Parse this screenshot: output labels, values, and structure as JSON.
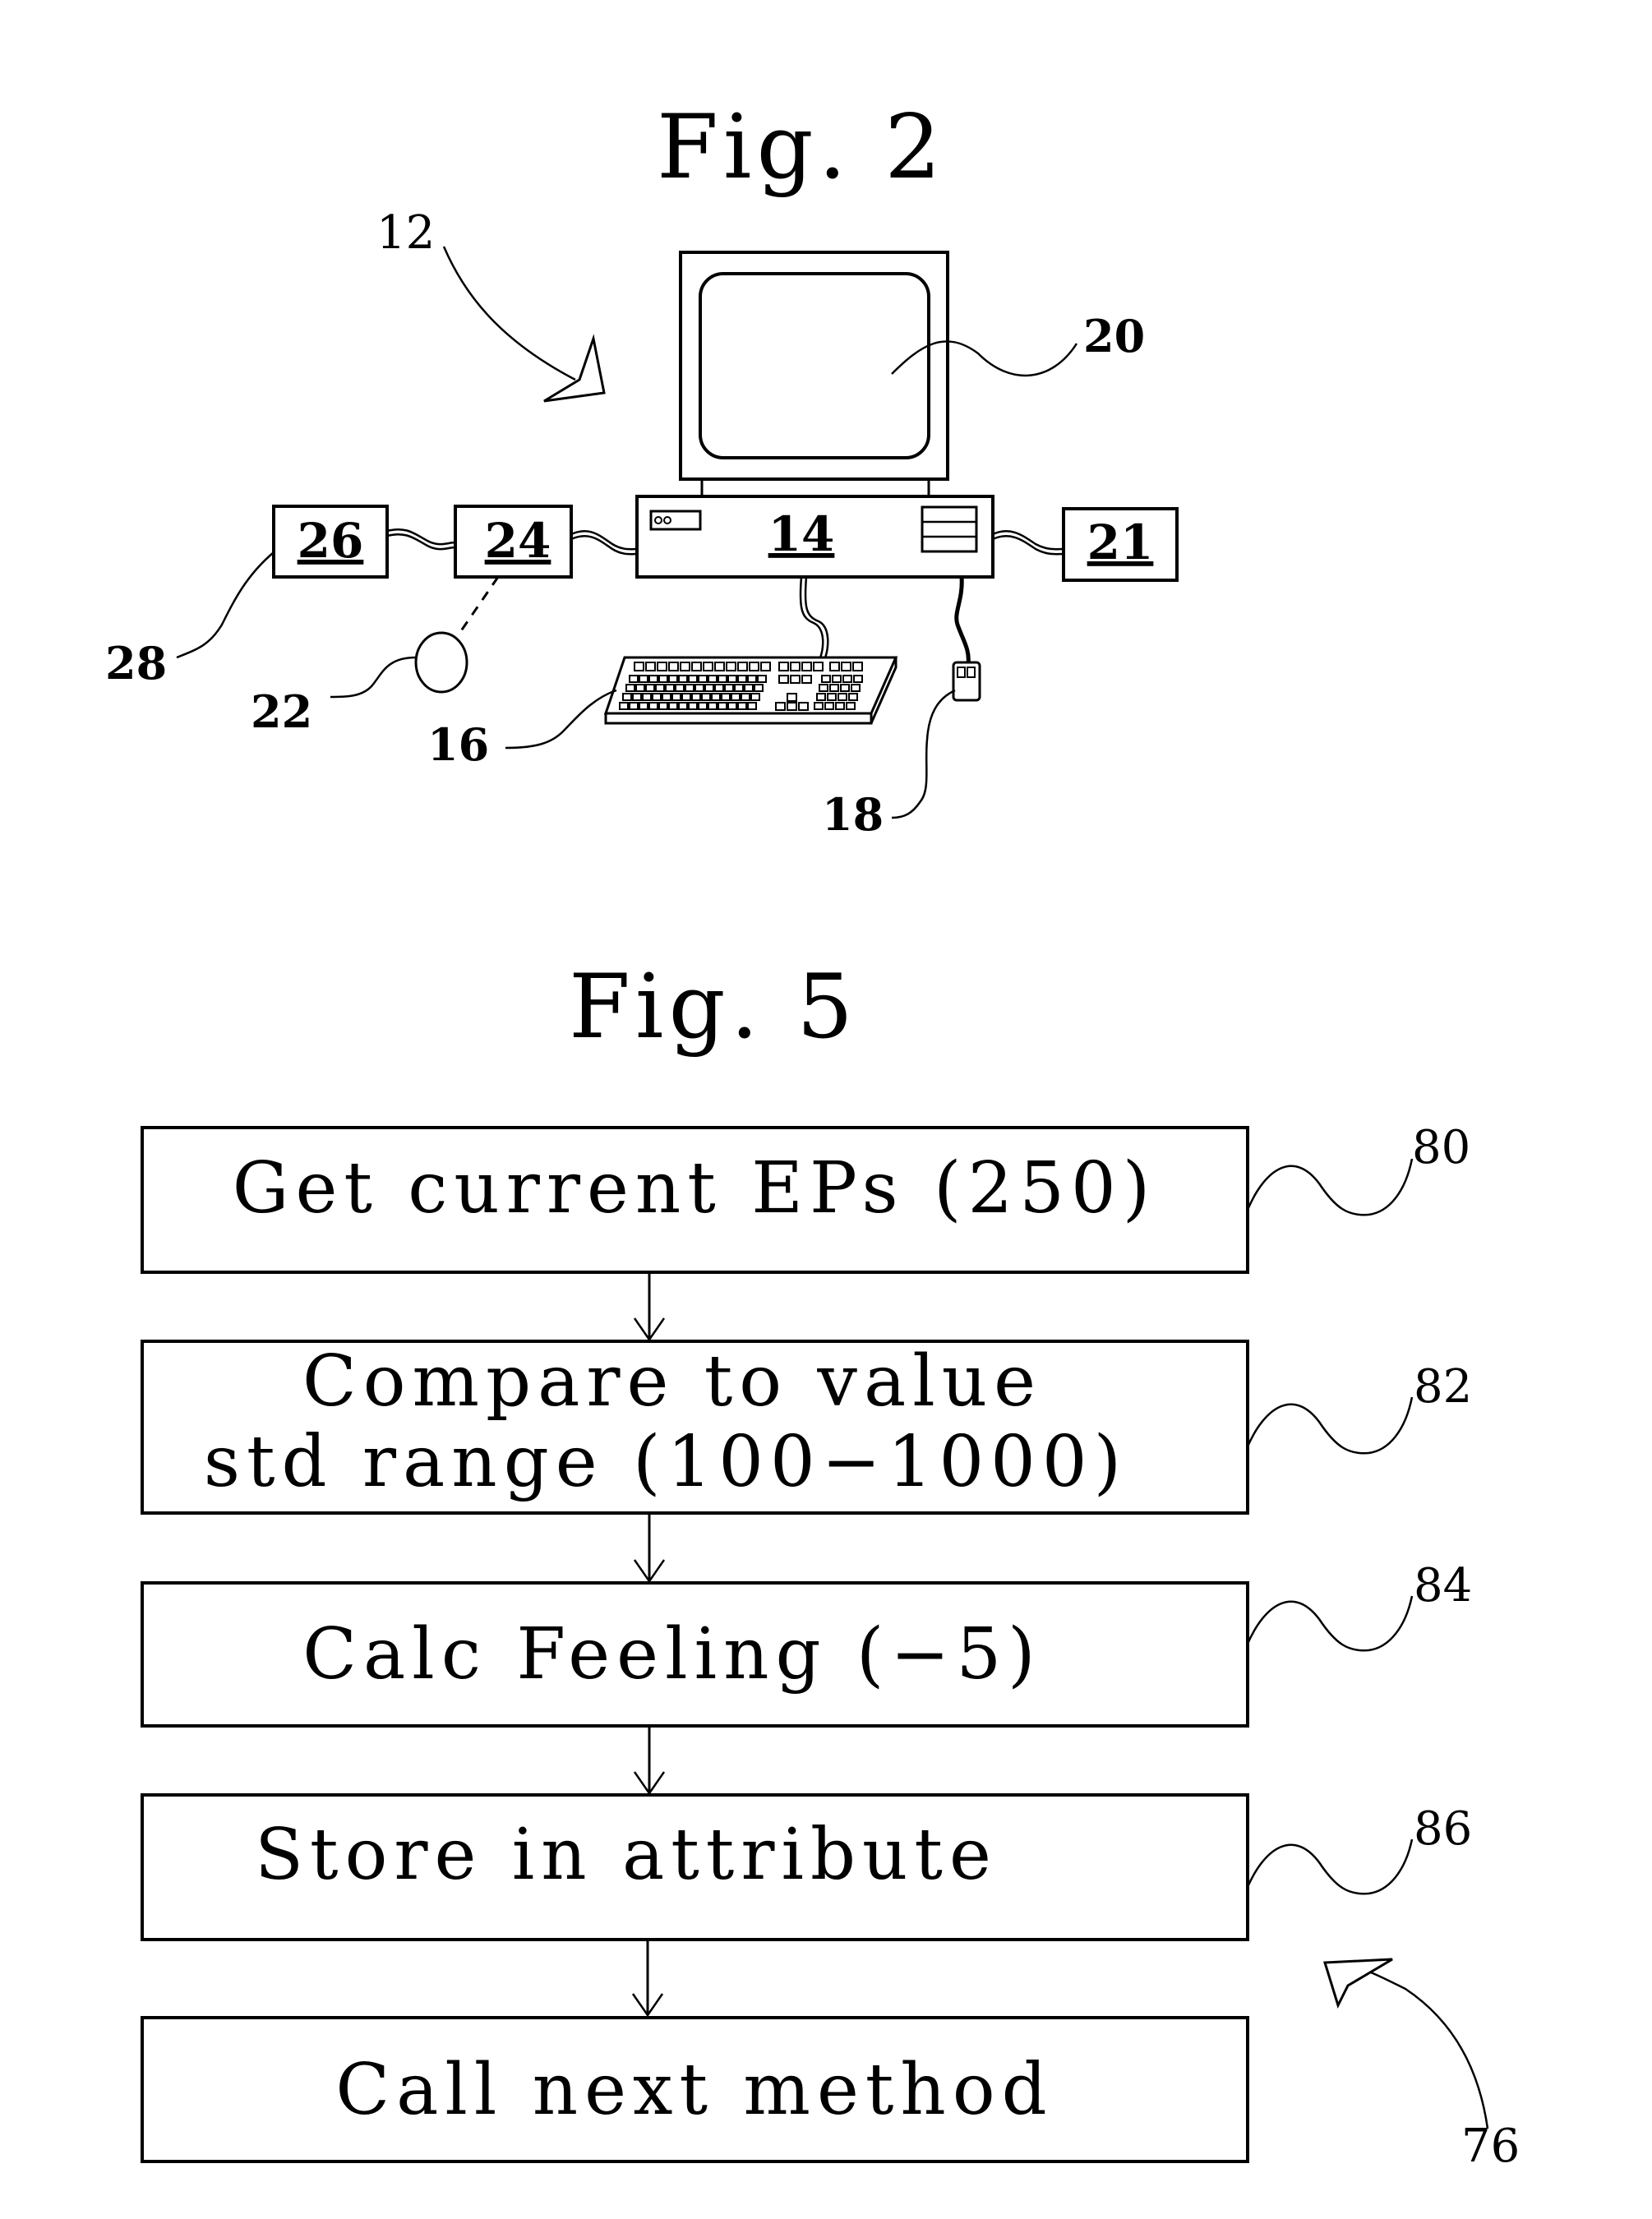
{
  "figures": [
    {
      "title": "Fig. 2",
      "callouts": {
        "system": "12",
        "cpu": "14",
        "keyboard": "16",
        "mouse": "18",
        "monitor": "20",
        "device_right": "21",
        "sensor": "22",
        "device_mid": "24",
        "device_left": "26",
        "device_left_lead": "28"
      }
    },
    {
      "title": "Fig. 5",
      "steps": [
        {
          "lines": [
            "Get current EPs (250)"
          ],
          "ref": "80"
        },
        {
          "lines": [
            "Compare to value",
            "std range (100−1000)"
          ],
          "ref": "82"
        },
        {
          "lines": [
            "Calc Feeling (−5)"
          ],
          "ref": "84"
        },
        {
          "lines": [
            "Store in attribute"
          ],
          "ref": "86"
        },
        {
          "lines": [
            "Call next method"
          ],
          "ref": ""
        }
      ],
      "flow_ref": "76"
    }
  ]
}
